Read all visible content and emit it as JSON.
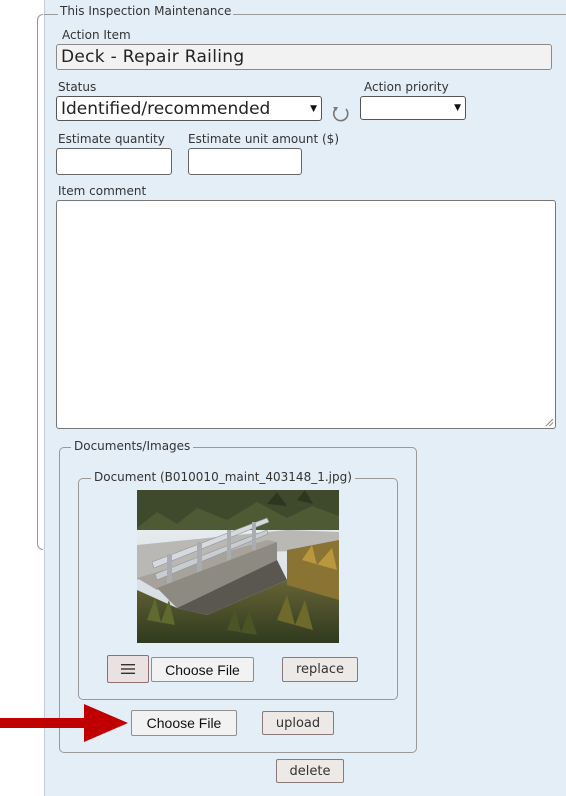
{
  "maintenance": {
    "legend": "This Inspection Maintenance",
    "action_item_label": "Action Item",
    "action_item_value": "Deck - Repair Railing",
    "status_label": "Status",
    "status_value": "Identified/recommended",
    "action_priority_label": "Action priority",
    "action_priority_value": "",
    "estimate_quantity_label": "Estimate quantity",
    "estimate_unit_amount_label": "Estimate unit amount ($)",
    "item_comment_label": "Item comment",
    "delete_label": "delete"
  },
  "documents": {
    "legend": "Documents/Images",
    "document_legend": "Document (B010010_maint_403148_1.jpg)",
    "choose_file_label": "Choose File",
    "replace_label": "replace",
    "upload_choose_file_label": "Choose File",
    "upload_label": "upload"
  },
  "icons": {
    "refresh": "refresh-icon",
    "menu": "hamburger-menu-icon",
    "arrow": "red-arrow-pointer"
  },
  "colors": {
    "panel_bg": "#e4eef6",
    "arrow": "#c00000"
  }
}
